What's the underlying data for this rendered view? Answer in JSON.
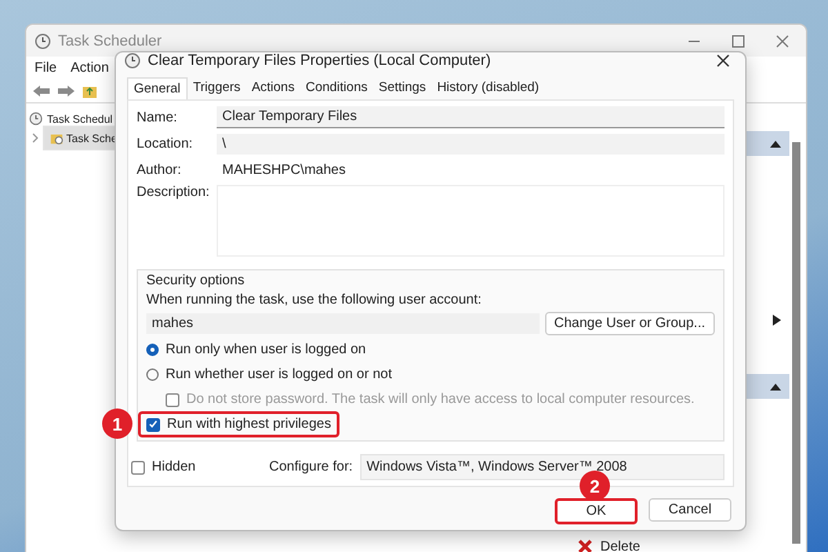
{
  "main_window": {
    "title": "Task Scheduler",
    "menu": [
      "File",
      "Action"
    ],
    "tree": [
      {
        "label": "Task Schedul",
        "selected": false,
        "children": [
          {
            "label": "Task Sche",
            "selected": true
          }
        ]
      }
    ],
    "actions": [
      {
        "label": "Delete"
      }
    ]
  },
  "dialog": {
    "title": "Clear Temporary Files Properties (Local Computer)",
    "tabs": [
      {
        "label": "General",
        "selected": true
      },
      {
        "label": "Triggers",
        "selected": false
      },
      {
        "label": "Actions",
        "selected": false
      },
      {
        "label": "Conditions",
        "selected": false
      },
      {
        "label": "Settings",
        "selected": false
      },
      {
        "label": "History (disabled)",
        "selected": false
      }
    ],
    "fields": [
      {
        "label": "Name:",
        "value": "Clear Temporary Files",
        "kind": "input"
      },
      {
        "label": "Location:",
        "value": "\\",
        "kind": "readonly"
      },
      {
        "label": "Author:",
        "value": "MAHESHPC\\mahes",
        "kind": "plain"
      },
      {
        "label": "Description:",
        "kind": "textarea"
      }
    ],
    "security": {
      "title": "Security options",
      "prompt": "When running the task, use the following user account:",
      "account": "mahes",
      "change_button": "Change User or Group...",
      "radios": [
        {
          "label": "Run only when user is logged on",
          "selected": true
        },
        {
          "label": "Run whether user is logged on or not",
          "selected": false
        }
      ],
      "no_password": {
        "label": "Do not store password.  The task will only have access to local computer resources.",
        "checked": false,
        "disabled": true
      },
      "highest": {
        "label": "Run with highest privileges",
        "checked": true,
        "callout": "1"
      }
    },
    "hidden": {
      "label": "Hidden",
      "checked": false
    },
    "configure": {
      "label": "Configure for:",
      "value": "Windows Vista™, Windows Server™ 2008"
    },
    "buttons": [
      {
        "label": "OK",
        "callout": "2"
      },
      {
        "label": "Cancel"
      }
    ]
  }
}
